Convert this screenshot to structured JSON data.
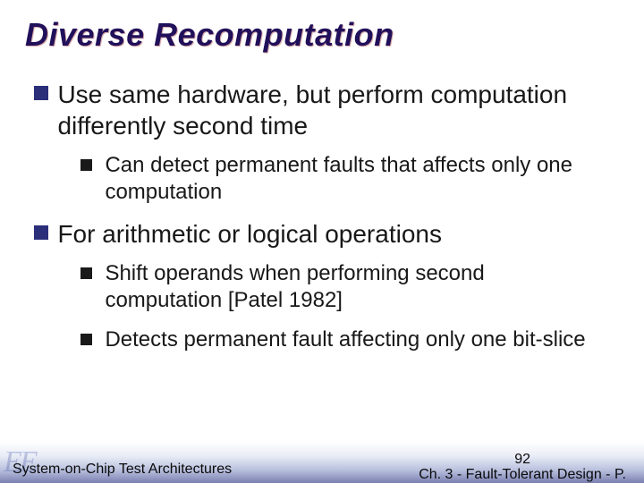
{
  "title": "Diverse Recomputation",
  "bullets": [
    {
      "text": "Use same hardware, but perform computation differently second time",
      "sub": [
        "Can detect permanent faults that affects only one computation"
      ]
    },
    {
      "text": "For arithmetic or logical operations",
      "sub": [
        "Shift operands when performing second computation [Patel 1982]",
        "Detects permanent fault affecting only one bit-slice"
      ]
    }
  ],
  "footer": {
    "left": "System-on-Chip Test Architectures",
    "page": "92",
    "chapter": "Ch. 3 - Fault-Tolerant Design - P."
  },
  "watermark": "EE"
}
